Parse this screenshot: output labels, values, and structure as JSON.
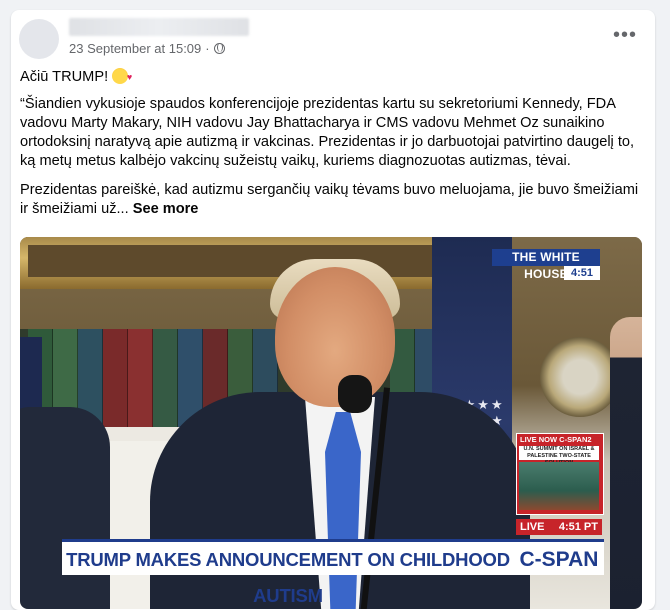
{
  "post": {
    "timestamp": "23 September at 15:09",
    "separator": "·",
    "privacy_icon": "globe-icon",
    "more_icon": "more-icon",
    "headline": "Ačiū TRUMP!",
    "emoji": "smiling-face-with-hearts",
    "paragraph1": "“Šiandien vykusioje spaudos konferencijoje prezidentas kartu su sekretoriumi Kennedy, FDA vadovu Marty Makary, NIH vadovu Jay Bhattacharya ir CMS vadovu Mehmet Oz sunaikino ortodoksinį naratyvą apie autizmą ir vakcinas. Prezidentas ir jo darbuotojai patvirtino daugelį to, ką metų metus kalbėjo vakcinų sužeistų vaikų, kuriems diagnozuotas autizmas, tėvai.",
    "paragraph2": "Prezidentas pareiškė, kad autizmu sergančių vaikų tėvams buvo meluojama, jie buvo šmeižiami ir šmeižiami už...",
    "see_more": "See more"
  },
  "video": {
    "network_badge": "THE WHITE HOUSE",
    "clock": "4:51",
    "pip_label": "LIVE NOW C-SPAN2",
    "pip_caption": "U.N. SUMMIT ON ISRAEL & PALESTINE TWO-STATE SOLUTION",
    "live_label": "LIVE",
    "live_time": "4:51 PT",
    "headline": "TRUMP MAKES ANNOUNCEMENT ON CHILDHOOD AUTISM",
    "network_logo": "C-SPAN"
  }
}
